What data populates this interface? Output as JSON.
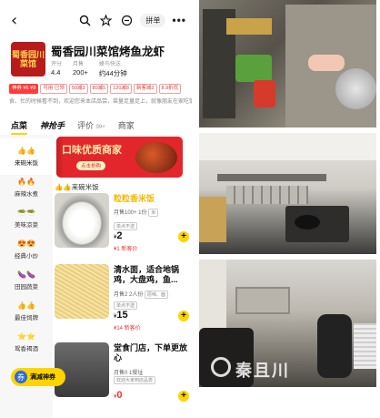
{
  "header": {
    "back_icon": "back-arrow-icon",
    "pin_label": "拼单",
    "more_label": "•••"
  },
  "shop": {
    "logo_text": "蜀香园川菜馆",
    "name": "蜀香园川菜馆烤鱼龙虾",
    "stats": [
      {
        "label": "评分",
        "value": "4.4"
      },
      {
        "label": "月售",
        "value": "200+"
      },
      {
        "label": "蜂鸟快送",
        "value": "约44分钟"
      }
    ]
  },
  "coupons": [
    "神券 ¥6 ¥8",
    "可用 已领",
    "50减3",
    "80减5",
    "120减8",
    "新客减2",
    "8.9折优"
  ],
  "notice": "食、忙的时候看不到，欢迎您来本店品尝，菜量足量足上，就像朋友在家吃饭",
  "tabs": [
    {
      "label": "点菜",
      "active": true
    },
    {
      "label": "神抢手",
      "brand": true
    },
    {
      "label": "评价",
      "count": "99+"
    },
    {
      "label": "商家"
    }
  ],
  "sidebar": [
    {
      "emoji": "👍👍",
      "label": "来碗米饭",
      "active": true
    },
    {
      "emoji": "🔥🔥",
      "label": "麻辣水煮"
    },
    {
      "emoji": "🥗🥗",
      "label": "美味凉菜"
    },
    {
      "emoji": "😍😍",
      "label": "经典小炒"
    },
    {
      "emoji": "🍆🍆",
      "label": "田园蔬菜"
    },
    {
      "emoji": "👍👍",
      "label": "最佳饲牌"
    },
    {
      "emoji": "⭐⭐",
      "label": "鸳香褐酒"
    }
  ],
  "promo": {
    "title": "口味优质商家",
    "button": "点击抢购"
  },
  "category_title": "👍👍来碗米饭",
  "dishes": [
    {
      "name": "粒粒香米饭",
      "meta1": "月售100+ 1份",
      "tag": "米",
      "limit": "单点不送",
      "price": "2",
      "sub_price": "¥1 新客价",
      "highlight": true
    },
    {
      "name": "清水面，适合地锅鸡，大盘鸡，鱼...",
      "meta1": "月售2 2人份",
      "tag": "原味、面",
      "limit": "单点不送",
      "price": "15",
      "sub_price": "¥14 新客价",
      "highlight": false
    },
    {
      "name": "堂食门店，下单更放心",
      "meta1": "月售0 1餐址",
      "tag": "欢迎大家到店品尝",
      "limit": "",
      "price": "0",
      "sub_price": "",
      "highlight": false
    }
  ],
  "cart": {
    "label": "满减神券"
  },
  "watermark": {
    "text": "秦且川"
  }
}
